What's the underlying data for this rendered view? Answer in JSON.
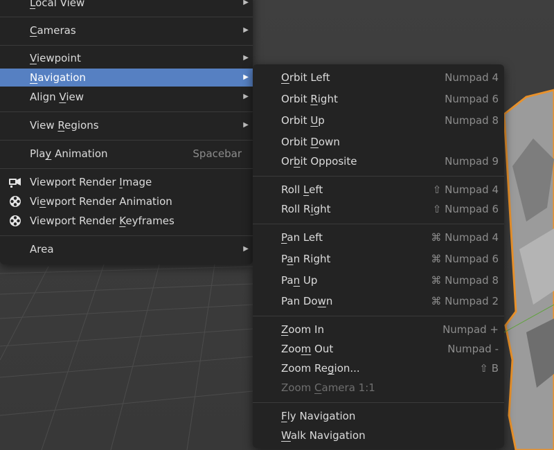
{
  "main_menu": {
    "items": [
      {
        "pre": "",
        "mn": "L",
        "post": "ocal View"
      },
      {
        "pre": "",
        "mn": "C",
        "post": "ameras"
      },
      {
        "pre": "",
        "mn": "V",
        "post": "iewpoint"
      },
      {
        "pre": "",
        "mn": "N",
        "post": "avigation"
      },
      {
        "pre": "Align ",
        "mn": "V",
        "post": "iew"
      },
      {
        "pre": "View ",
        "mn": "R",
        "post": "egions"
      },
      {
        "pre": "Pla",
        "mn": "y",
        "post": " Animation",
        "shortcut": "Spacebar"
      },
      {
        "pre": "Viewport Render ",
        "mn": "I",
        "post": "mage"
      },
      {
        "pre": "Vi",
        "mn": "e",
        "post": "wport Render Animation"
      },
      {
        "pre": "Viewport Render ",
        "mn": "K",
        "post": "eyframes"
      },
      {
        "pre": "Area",
        "mn": "",
        "post": ""
      }
    ],
    "icons": [
      "camera-render-icon",
      "film-reel-icon",
      "film-reel-icon"
    ]
  },
  "navigation_menu": {
    "items": [
      {
        "pre": "",
        "mn": "O",
        "post": "rbit Left",
        "shortcut": "Numpad 4"
      },
      {
        "pre": "Orbit ",
        "mn": "R",
        "post": "ight",
        "shortcut": "Numpad 6"
      },
      {
        "pre": "Orbit ",
        "mn": "U",
        "post": "p",
        "shortcut": "Numpad 8"
      },
      {
        "pre": "Orbit ",
        "mn": "D",
        "post": "own",
        "shortcut": ""
      },
      {
        "pre": "Or",
        "mn": "b",
        "post": "it Opposite",
        "shortcut": "Numpad 9"
      },
      {
        "pre": "Roll ",
        "mn": "L",
        "post": "eft",
        "shortcut": "⇧ Numpad 4"
      },
      {
        "pre": "Roll R",
        "mn": "i",
        "post": "ght",
        "shortcut": "⇧ Numpad 6"
      },
      {
        "pre": "",
        "mn": "P",
        "post": "an Left",
        "shortcut": "⌘ Numpad 4"
      },
      {
        "pre": "P",
        "mn": "a",
        "post": "n Right",
        "shortcut": "⌘ Numpad 6"
      },
      {
        "pre": "Pa",
        "mn": "n",
        "post": " Up",
        "shortcut": "⌘ Numpad 8"
      },
      {
        "pre": "Pan Do",
        "mn": "w",
        "post": "n",
        "shortcut": "⌘ Numpad 2"
      },
      {
        "pre": "",
        "mn": "Z",
        "post": "oom In",
        "shortcut": "Numpad +"
      },
      {
        "pre": "Zoo",
        "mn": "m",
        "post": " Out",
        "shortcut": "Numpad -"
      },
      {
        "pre": "Zoom Re",
        "mn": "g",
        "post": "ion...",
        "shortcut": "⇧ B"
      },
      {
        "pre": "Zoom ",
        "mn": "C",
        "post": "amera 1:1",
        "shortcut": ""
      },
      {
        "pre": "",
        "mn": "F",
        "post": "ly Navigation",
        "shortcut": ""
      },
      {
        "pre": "",
        "mn": "W",
        "post": "alk Navigation",
        "shortcut": ""
      }
    ]
  },
  "colors": {
    "menu_bg": "#232323",
    "highlight": "#5680c2",
    "viewport_bg": "#3a3a3a",
    "grid": "#4a4a4a",
    "selection_outline": "#e8912b",
    "mesh": "#9b9b9b"
  }
}
